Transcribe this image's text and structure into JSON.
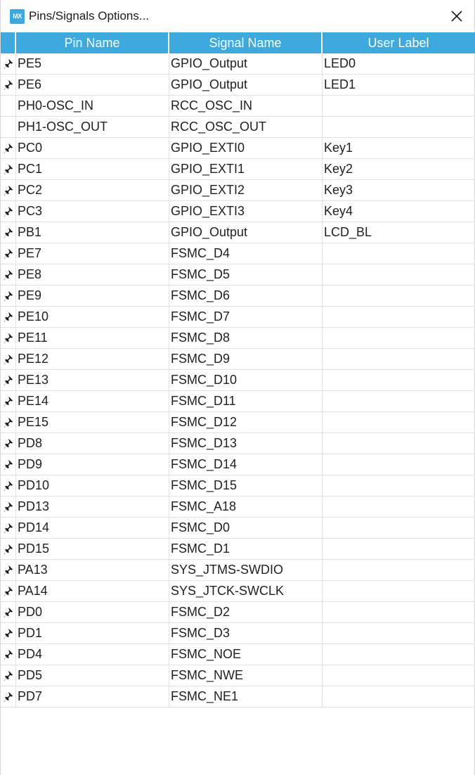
{
  "window": {
    "logo_text": "MX",
    "title": "Pins/Signals Options..."
  },
  "table": {
    "columns": [
      "Pin Name",
      "Signal Name",
      "User Label"
    ],
    "rows": [
      {
        "pinned": true,
        "pin": "PE5",
        "signal": "GPIO_Output",
        "label": "LED0"
      },
      {
        "pinned": true,
        "pin": "PE6",
        "signal": "GPIO_Output",
        "label": "LED1"
      },
      {
        "pinned": false,
        "pin": "PH0-OSC_IN",
        "signal": "RCC_OSC_IN",
        "label": ""
      },
      {
        "pinned": false,
        "pin": "PH1-OSC_OUT",
        "signal": "RCC_OSC_OUT",
        "label": ""
      },
      {
        "pinned": true,
        "pin": "PC0",
        "signal": "GPIO_EXTI0",
        "label": "Key1"
      },
      {
        "pinned": true,
        "pin": "PC1",
        "signal": "GPIO_EXTI1",
        "label": "Key2"
      },
      {
        "pinned": true,
        "pin": "PC2",
        "signal": "GPIO_EXTI2",
        "label": "Key3"
      },
      {
        "pinned": true,
        "pin": "PC3",
        "signal": "GPIO_EXTI3",
        "label": "Key4"
      },
      {
        "pinned": true,
        "pin": "PB1",
        "signal": "GPIO_Output",
        "label": "LCD_BL"
      },
      {
        "pinned": true,
        "pin": "PE7",
        "signal": "FSMC_D4",
        "label": ""
      },
      {
        "pinned": true,
        "pin": "PE8",
        "signal": "FSMC_D5",
        "label": ""
      },
      {
        "pinned": true,
        "pin": "PE9",
        "signal": "FSMC_D6",
        "label": ""
      },
      {
        "pinned": true,
        "pin": "PE10",
        "signal": "FSMC_D7",
        "label": ""
      },
      {
        "pinned": true,
        "pin": "PE11",
        "signal": "FSMC_D8",
        "label": ""
      },
      {
        "pinned": true,
        "pin": "PE12",
        "signal": "FSMC_D9",
        "label": ""
      },
      {
        "pinned": true,
        "pin": "PE13",
        "signal": "FSMC_D10",
        "label": ""
      },
      {
        "pinned": true,
        "pin": "PE14",
        "signal": "FSMC_D11",
        "label": ""
      },
      {
        "pinned": true,
        "pin": "PE15",
        "signal": "FSMC_D12",
        "label": ""
      },
      {
        "pinned": true,
        "pin": "PD8",
        "signal": "FSMC_D13",
        "label": ""
      },
      {
        "pinned": true,
        "pin": "PD9",
        "signal": "FSMC_D14",
        "label": ""
      },
      {
        "pinned": true,
        "pin": "PD10",
        "signal": "FSMC_D15",
        "label": ""
      },
      {
        "pinned": true,
        "pin": "PD13",
        "signal": "FSMC_A18",
        "label": ""
      },
      {
        "pinned": true,
        "pin": "PD14",
        "signal": "FSMC_D0",
        "label": ""
      },
      {
        "pinned": true,
        "pin": "PD15",
        "signal": "FSMC_D1",
        "label": ""
      },
      {
        "pinned": true,
        "pin": "PA13",
        "signal": "SYS_JTMS-SWDIO",
        "label": ""
      },
      {
        "pinned": true,
        "pin": "PA14",
        "signal": "SYS_JTCK-SWCLK",
        "label": ""
      },
      {
        "pinned": true,
        "pin": "PD0",
        "signal": "FSMC_D2",
        "label": ""
      },
      {
        "pinned": true,
        "pin": "PD1",
        "signal": "FSMC_D3",
        "label": ""
      },
      {
        "pinned": true,
        "pin": "PD4",
        "signal": "FSMC_NOE",
        "label": ""
      },
      {
        "pinned": true,
        "pin": "PD5",
        "signal": "FSMC_NWE",
        "label": ""
      },
      {
        "pinned": true,
        "pin": "PD7",
        "signal": "FSMC_NE1",
        "label": ""
      }
    ]
  },
  "colors": {
    "header_bg": "#3da9dd",
    "grid": "#e1e1e1"
  },
  "icons": {
    "app": "stm32cubemx-logo-icon",
    "close": "close-icon",
    "pinned": "pushpin-icon"
  }
}
